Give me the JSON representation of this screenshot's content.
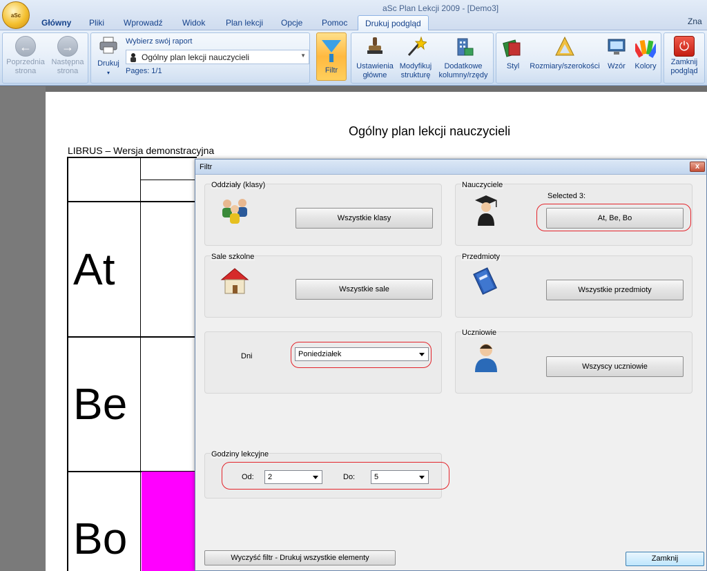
{
  "app": {
    "window_title": "aSc Plan Lekcji 2009  - [Demo3]",
    "title_right": "Zna",
    "logo_text": "aSc",
    "tabs": [
      "Główny",
      "Pliki",
      "Wprowadź",
      "Widok",
      "Plan lekcji",
      "Opcje",
      "Pomoc",
      "Drukuj podgląd"
    ],
    "active_tab": "Drukuj podgląd"
  },
  "ribbon": {
    "prev": [
      "Poprzednia",
      "strona"
    ],
    "next": [
      "Następna",
      "strona"
    ],
    "print": "Drukuj",
    "report_heading": "Wybierz swój raport",
    "report_value": "Ogólny plan lekcji nauczycieli",
    "pages": "Pages: 1/1",
    "filter": "Filtr",
    "main_settings": [
      "Ustawienia",
      "główne"
    ],
    "modify": [
      "Modyfikuj",
      "strukturę"
    ],
    "extra": [
      "Dodatkowe",
      "kolumny/rzędy"
    ],
    "style": "Styl",
    "sizes": "Rozmiary/szerokości",
    "pattern": "Wzór",
    "colors": "Kolory",
    "close_preview": [
      "Zamknij",
      "podgląd"
    ]
  },
  "page": {
    "title": "Ogólny plan lekcji nauczycieli",
    "subtitle": "LIBRUS – Wersja demonstracyjna",
    "teachers": [
      "At",
      "Be",
      "Bo"
    ]
  },
  "dialog": {
    "title": "Filtr",
    "close_glyph": "x",
    "classes": {
      "label": "Oddziały (klasy)",
      "button": "Wszystkie klasy"
    },
    "teachers": {
      "label": "Nauczyciele",
      "selected": "Selected 3:",
      "button": "At, Be, Bo"
    },
    "rooms": {
      "label": "Sale szkolne",
      "button": "Wszystkie sale"
    },
    "subjects": {
      "label": "Przedmioty",
      "button": "Wszystkie przedmioty"
    },
    "days": {
      "label": "Dni",
      "value": "Poniedziałek"
    },
    "students": {
      "label": "Uczniowie",
      "button": "Wszyscy uczniowie"
    },
    "hours": {
      "label": "Godziny lekcyjne",
      "from_label": "Od:",
      "from_value": "2",
      "to_label": "Do:",
      "to_value": "5"
    },
    "clear_button": "Wyczyść filtr - Drukuj wszystkie elementy",
    "close_button": "Zamknij"
  }
}
